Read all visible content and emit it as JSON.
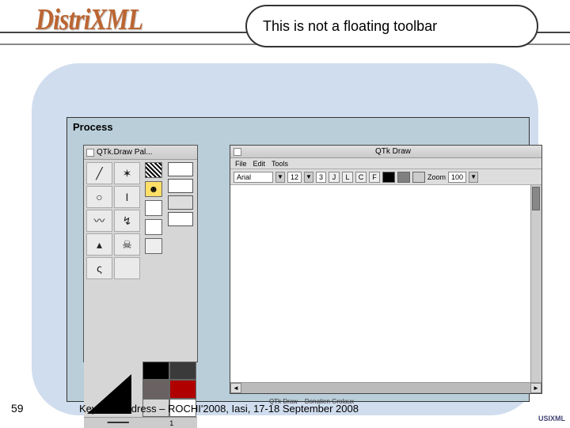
{
  "logo_text": "DistriXML",
  "title": "This is not a floating toolbar",
  "process_label": "Process",
  "palette": {
    "title": "QTk.Draw Pal...",
    "tool_glyphs": [
      "╱",
      "✶",
      "○",
      "I",
      "〰",
      "↯",
      "▴",
      "☠",
      "ς",
      ""
    ],
    "swatch_colors": [
      "#000000",
      "#3a3a3a",
      "#6a6262",
      "#b00000",
      "#d6d6d6"
    ],
    "face_glyph": "☻",
    "line_weight_val": "1"
  },
  "draw": {
    "title": "QTk Draw",
    "menus": [
      "File",
      "Edit",
      "Tools"
    ],
    "font_label": "Arial",
    "fsize1": "12",
    "fsize2": "3",
    "style_btns": [
      "J",
      "L",
      "C",
      "F"
    ],
    "zoom_label": "Zoom",
    "zoom_val": "100",
    "pattern_colors": [
      "#000000",
      "#808080",
      "#cccccc"
    ]
  },
  "sub_footer": "QTk Draw – Donatien Grolaux",
  "slide_number": "59",
  "footer": "Keynote address – ROCHI'2008, Iasi, 17-18 September 2008",
  "corner_logo": "USIXML"
}
